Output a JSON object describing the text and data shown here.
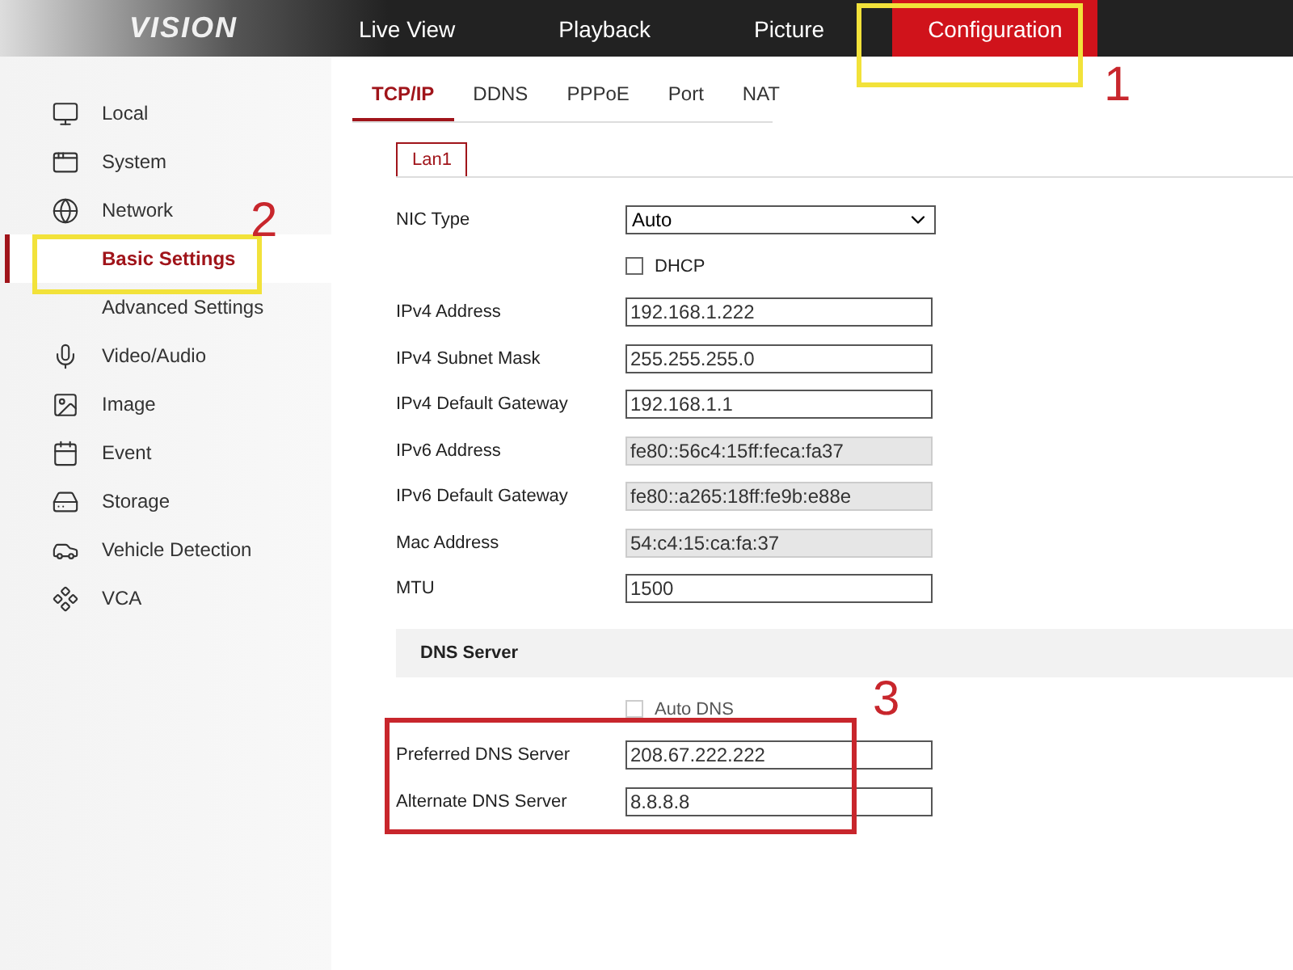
{
  "top_nav": {
    "logo": "VISION",
    "items": [
      {
        "label": "Live View",
        "selected": false
      },
      {
        "label": "Playback",
        "selected": false
      },
      {
        "label": "Picture",
        "selected": false
      },
      {
        "label": "Configuration",
        "selected": true
      }
    ]
  },
  "sidebar": {
    "items": [
      {
        "label": "Local",
        "selected": false
      },
      {
        "label": "System",
        "selected": false
      },
      {
        "label": "Network",
        "selected": false,
        "children": [
          {
            "label": "Basic Settings",
            "selected": true
          },
          {
            "label": "Advanced Settings",
            "selected": false
          }
        ]
      },
      {
        "label": "Video/Audio",
        "selected": false
      },
      {
        "label": "Image",
        "selected": false
      },
      {
        "label": "Event",
        "selected": false
      },
      {
        "label": "Storage",
        "selected": false
      },
      {
        "label": "Vehicle Detection",
        "selected": false
      },
      {
        "label": "VCA",
        "selected": false
      }
    ]
  },
  "tabs": [
    {
      "label": "TCP/IP",
      "selected": true
    },
    {
      "label": "DDNS",
      "selected": false
    },
    {
      "label": "PPPoE",
      "selected": false
    },
    {
      "label": "Port",
      "selected": false
    },
    {
      "label": "NAT",
      "selected": false
    }
  ],
  "sub_tabs": [
    {
      "label": "Lan1",
      "selected": true
    }
  ],
  "fields": [
    {
      "kind": "select",
      "label": "NIC Type",
      "value": "Auto"
    },
    {
      "kind": "checkbox",
      "label": "DHCP",
      "checked": false,
      "disabled": false
    },
    {
      "kind": "input",
      "label": "IPv4 Address",
      "value": "192.168.1.222",
      "disabled": false
    },
    {
      "kind": "input",
      "label": "IPv4 Subnet Mask",
      "value": "255.255.255.0",
      "disabled": false
    },
    {
      "kind": "input",
      "label": "IPv4 Default Gateway",
      "value": "192.168.1.1",
      "disabled": false
    },
    {
      "kind": "input",
      "label": "IPv6 Address",
      "value": "fe80::56c4:15ff:feca:fa37",
      "disabled": true
    },
    {
      "kind": "input",
      "label": "IPv6 Default Gateway",
      "value": "fe80::a265:18ff:fe9b:e88e",
      "disabled": true
    },
    {
      "kind": "input",
      "label": "Mac Address",
      "value": "54:c4:15:ca:fa:37",
      "disabled": true
    },
    {
      "kind": "input",
      "label": "MTU",
      "value": "1500",
      "disabled": false
    }
  ],
  "dns": {
    "title": "DNS Server",
    "fields": [
      {
        "kind": "checkbox",
        "label": "Auto DNS",
        "checked": false,
        "disabled": true
      },
      {
        "kind": "input",
        "label": "Preferred DNS Server",
        "value": "208.67.222.222",
        "disabled": false
      },
      {
        "kind": "input",
        "label": "Alternate DNS Server",
        "value": "8.8.8.8",
        "disabled": false
      }
    ]
  },
  "annotations": [
    {
      "number": "1"
    },
    {
      "number": "2"
    },
    {
      "number": "3"
    }
  ]
}
